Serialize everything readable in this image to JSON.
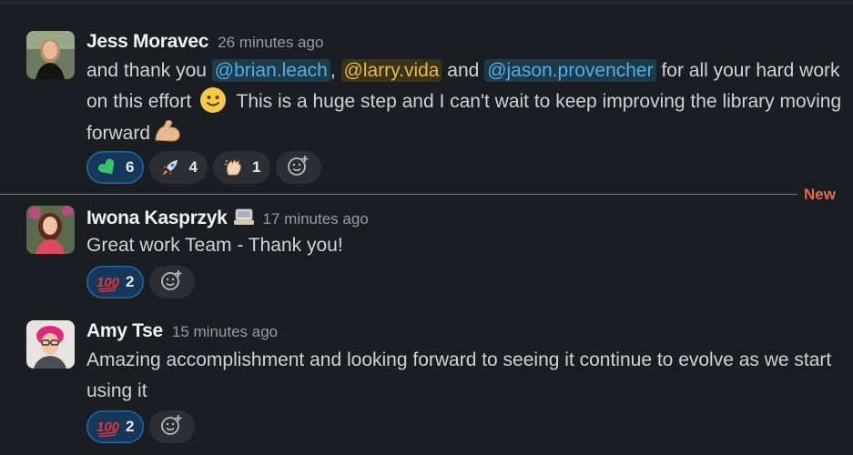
{
  "messages": [
    {
      "author": "Jess Moravec",
      "time": "26 minutes ago",
      "text": {
        "pre": "and thank you ",
        "mention1": "@brian.leach",
        "sep1": ", ",
        "mention2": "@larry.vida",
        "sep2": " and ",
        "mention3": "@jason.provencher",
        "mid": " for all your hard work on this effort ",
        "post": "  This is a huge step and I can't wait to keep improving the library moving forward"
      },
      "reactions": [
        {
          "icon": "green-heart-emoji",
          "count": "6",
          "active": true
        },
        {
          "icon": "rocket-emoji",
          "count": "4",
          "active": false
        },
        {
          "icon": "clapping-hands-emoji",
          "count": "1",
          "active": false
        }
      ]
    },
    {
      "author": "Iwona Kasprzyk",
      "status_icon": "computer-emoji",
      "time": "17 minutes ago",
      "text": "Great work Team - Thank you!",
      "reactions": [
        {
          "icon": "hundred-points-emoji",
          "count": "2",
          "active": true
        }
      ]
    },
    {
      "author": "Amy Tse",
      "time": "15 minutes ago",
      "text": "Amazing accomplishment and looking forward to seeing it continue to evolve as we start using it",
      "reactions": [
        {
          "icon": "hundred-points-emoji",
          "count": "2",
          "active": true
        }
      ]
    }
  ],
  "divider": {
    "label": "New"
  },
  "colors": {
    "background": "#1a1d21",
    "divider": "#c8553d",
    "mention_blue": "#4fb0e8",
    "mention_gold": "#e8b84a",
    "active_reaction": "#17375a"
  }
}
